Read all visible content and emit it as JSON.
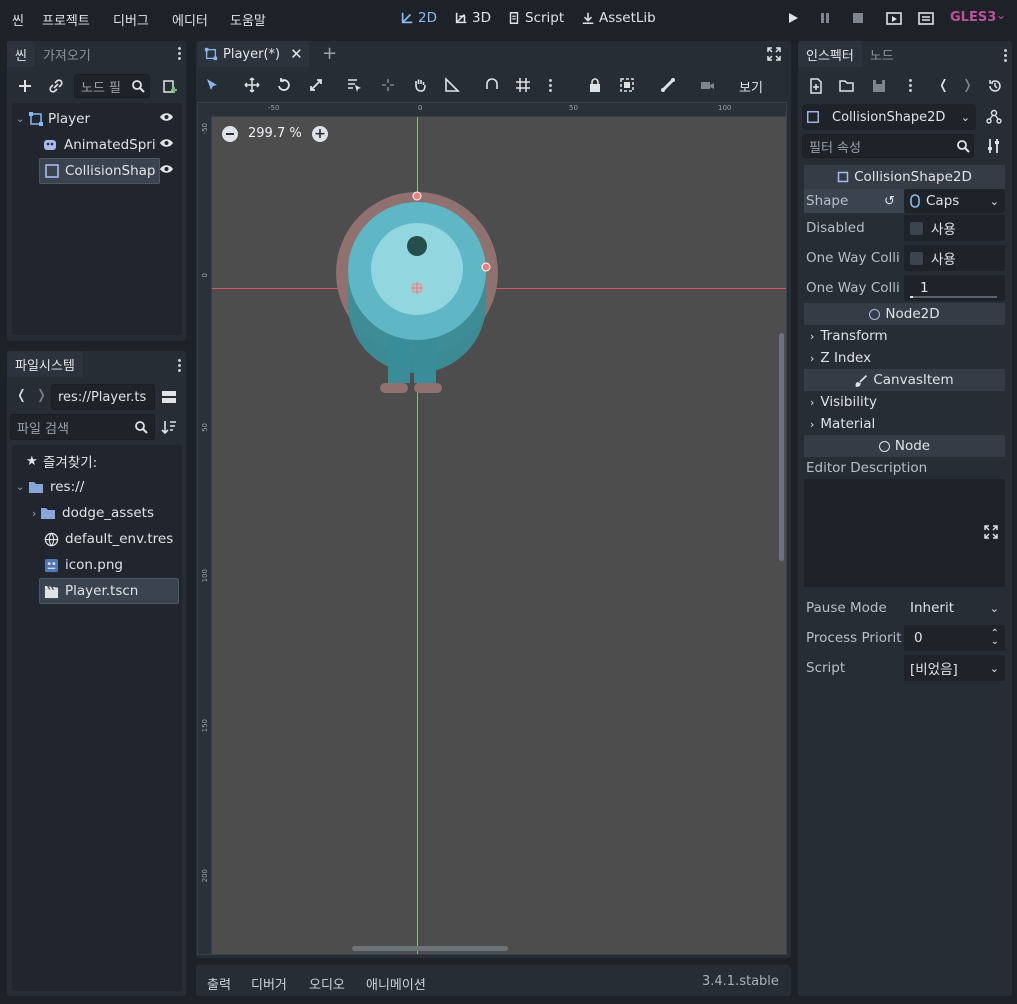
{
  "menu": [
    "씬",
    "프로젝트",
    "디버그",
    "에디터",
    "도움말"
  ],
  "modes": {
    "two_d": "2D",
    "three_d": "3D",
    "script": "Script",
    "assetlib": "AssetLib"
  },
  "renderer": "GLES3",
  "scene_dock": {
    "tabs": [
      "씬",
      "가져오기"
    ],
    "filter_placeholder": "노드 필",
    "nodes": [
      {
        "name": "Player",
        "icon": "node2d-icon"
      },
      {
        "name": "AnimatedSpri",
        "icon": "animated-sprite-icon"
      },
      {
        "name": "CollisionShap",
        "icon": "collision-shape-icon"
      }
    ]
  },
  "filesystem": {
    "tab": "파일시스템",
    "path": "res://Player.ts",
    "search_placeholder": "파일 검색",
    "favorites": "즐겨찾기:",
    "root": "res://",
    "items": [
      "dodge_assets",
      "default_env.tres",
      "icon.png",
      "Player.tscn"
    ]
  },
  "viewport": {
    "tab_title": "Player(*)",
    "zoom": "299.7 %",
    "view_menu": "보기",
    "h_ticks": [
      "-50",
      "0",
      "50",
      "100"
    ],
    "v_ticks": [
      "-50",
      "0",
      "50",
      "100",
      "150",
      "200"
    ]
  },
  "bottom_panel": {
    "tabs": [
      "출력",
      "디버거",
      "오디오",
      "애니메이션"
    ],
    "version": "3.4.1.stable"
  },
  "inspector": {
    "tabs": [
      "인스펙터",
      "노드"
    ],
    "object": "CollisionShape2D",
    "filter_placeholder": "필터 속성",
    "header": "CollisionShape2D",
    "properties": {
      "shape_label": "Shape",
      "shape_value": "Caps",
      "disabled_label": "Disabled",
      "disabled_value": "사용",
      "oneway_label": "One Way Colli",
      "oneway_value": "사용",
      "oneway_margin_label": "One Way Colli",
      "oneway_margin_value": "1"
    },
    "node2d_section": "Node2D",
    "transform": "Transform",
    "zindex": "Z Index",
    "canvasitem_section": "CanvasItem",
    "visibility": "Visibility",
    "material": "Material",
    "node_section": "Node",
    "editor_description": "Editor Description",
    "pause_mode_label": "Pause Mode",
    "pause_mode_value": "Inherit",
    "process_priority_label": "Process Priorit",
    "process_priority_value": "0",
    "script_label": "Script",
    "script_value": "[비었음]"
  },
  "colors": {
    "accent": "#8bb7f0",
    "renderer": "#c0509a",
    "bg": "#1d2229",
    "panel": "#272d35",
    "viewport": "#4d4d4d"
  }
}
